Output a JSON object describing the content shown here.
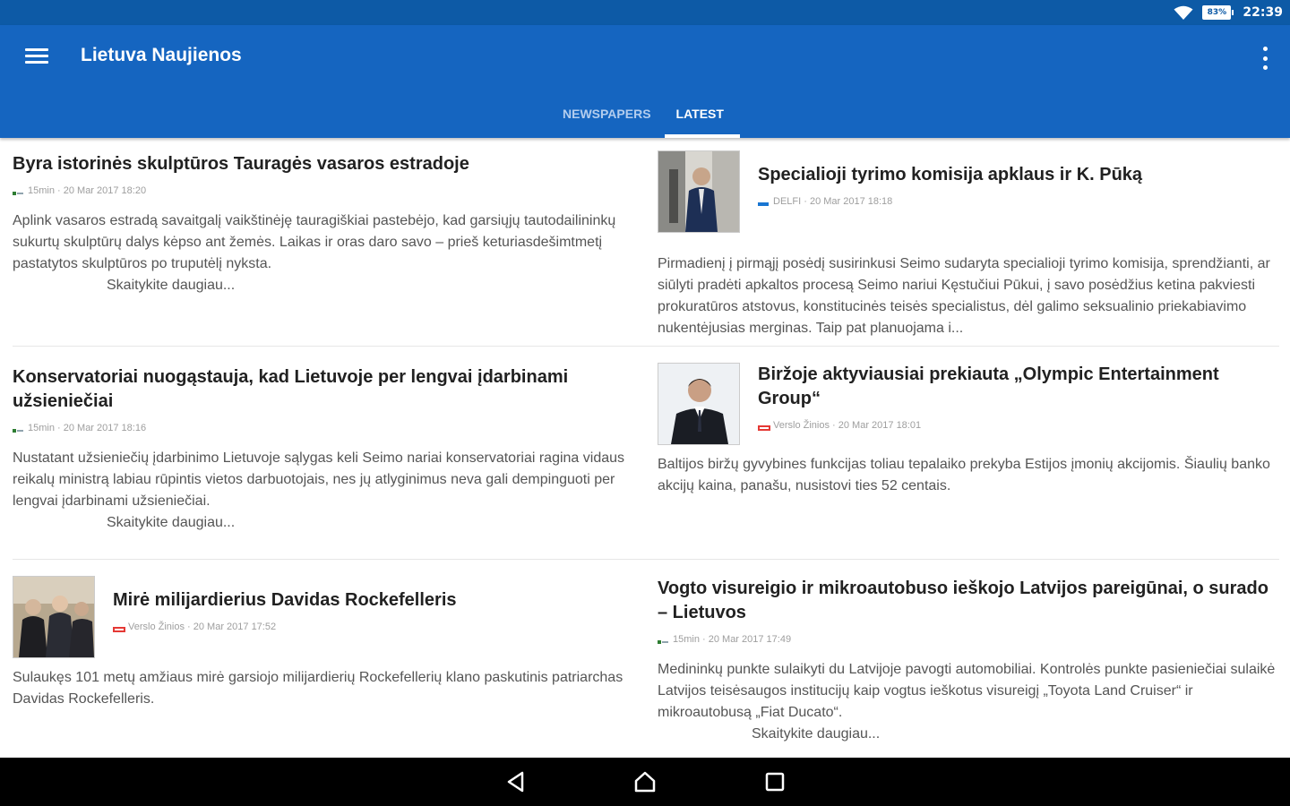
{
  "status": {
    "battery": "83%",
    "time": "22:39"
  },
  "appbar": {
    "title": "Lietuva Naujienos"
  },
  "tabs": [
    {
      "label": "NEWSPAPERS"
    },
    {
      "label": "LATEST"
    }
  ],
  "colors": {
    "status_bar": "#0d5aa6",
    "app_bar": "#1565c0",
    "tab_inactive": "#b3cdee",
    "nav_bar": "#000000"
  },
  "articles": [
    {
      "title": "Byra istorinės skulptūros Tauragės vasaros estradoje",
      "meta": "15min · 20 Mar 2017 18:20",
      "summary": "Aplink vasaros estradą savaitgalį vaikštinėję tauragiškiai pastebėjo, kad garsiųjų tautodailininkų sukurtų skulptūrų dalys kėpso ant žemės. Laikas ir oras daro savo – prieš keturiasdešimtmetį pastatytos skulptūros po truputėlį nyksta.",
      "read_more": "Skaitykite daugiau..."
    },
    {
      "title": "Specialioji tyrimo komisija apklaus ir K. Pūką",
      "meta": "DELFI · 20 Mar 2017 18:18",
      "summary": "Pirmadienį į pirmąjį posėdį susirinkusi Seimo sudaryta specialioji tyrimo komisija, sprendžianti, ar siūlyti pradėti apkaltos procesą Seimo nariui Kęstučiui Pūkui, į savo posėdžius ketina pakviesti prokuratūros atstovus, konstitucinės teisės specialistus, dėl galimo seksualinio priekabiavimo nukentėjusias merginas. Taip pat planuojama i..."
    },
    {
      "title": "Konservatoriai nuogąstauja, kad Lietuvoje per lengvai įdarbinami užsieniečiai",
      "meta": "15min · 20 Mar 2017 18:16",
      "summary": "Nustatant užsieniečių įdarbinimo Lietuvoje sąlygas keli Seimo nariai konservatoriai ragina vidaus reikalų ministrą labiau rūpintis vietos darbuotojais, nes jų atlyginimus neva gali dempinguoti per lengvai įdarbinami užsieniečiai.",
      "read_more": "Skaitykite daugiau..."
    },
    {
      "title": "Biržoje aktyviausiai prekiauta „Olympic Entertainment Group“",
      "meta": "Verslo Žinios · 20 Mar 2017 18:01",
      "summary": "Baltijos biržų gyvybines funkcijas toliau tepalaiko prekyba Estijos įmonių akcijomis. Šiaulių banko akcijų kaina, panašu, nusistovi ties 52 centais."
    },
    {
      "title": "Mirė milijardierius Davidas Rockefelleris",
      "meta": "Verslo Žinios · 20 Mar 2017 17:52",
      "summary": "Sulaukęs 101 metų amžiaus mirė garsiojo milijardierių Rockefellerių klano paskutinis patriarchas Davidas Rockefelleris."
    },
    {
      "title": "Vogto visureigio ir mikroautobuso ieškojo Latvijos pareigūnai, o surado – Lietuvos",
      "meta": "15min · 20 Mar 2017 17:49",
      "summary": "Medininkų punkte sulaikyti du Latvijoje pavogti automobiliai. Kontrolės punkte pasieniečiai sulaikė Latvijos teisėsaugos institucijų kaip vogtus ieškotus visureigį „Toyota Land Cruiser“ ir mikroautobusą „Fiat Ducato“.",
      "read_more": "Skaitykite daugiau..."
    }
  ]
}
